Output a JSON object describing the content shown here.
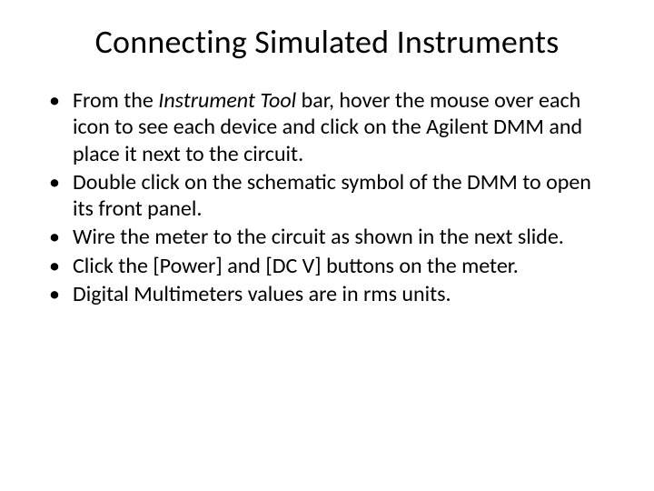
{
  "title": "Connecting Simulated Instruments",
  "bullets": {
    "b0_pre": "From the ",
    "b0_italic": "Instrument Tool",
    "b0_post": " bar, hover the mouse over each icon to see each device and click on the Agilent DMM and place it next to the circuit.",
    "b1": "Double click on the schematic symbol of the DMM to open its front panel.",
    "b2": "Wire the meter to the circuit as shown in the next slide.",
    "b3": "Click the [Power] and [DC V] buttons on the meter.",
    "b4": "Digital Multimeters values are in rms units."
  }
}
